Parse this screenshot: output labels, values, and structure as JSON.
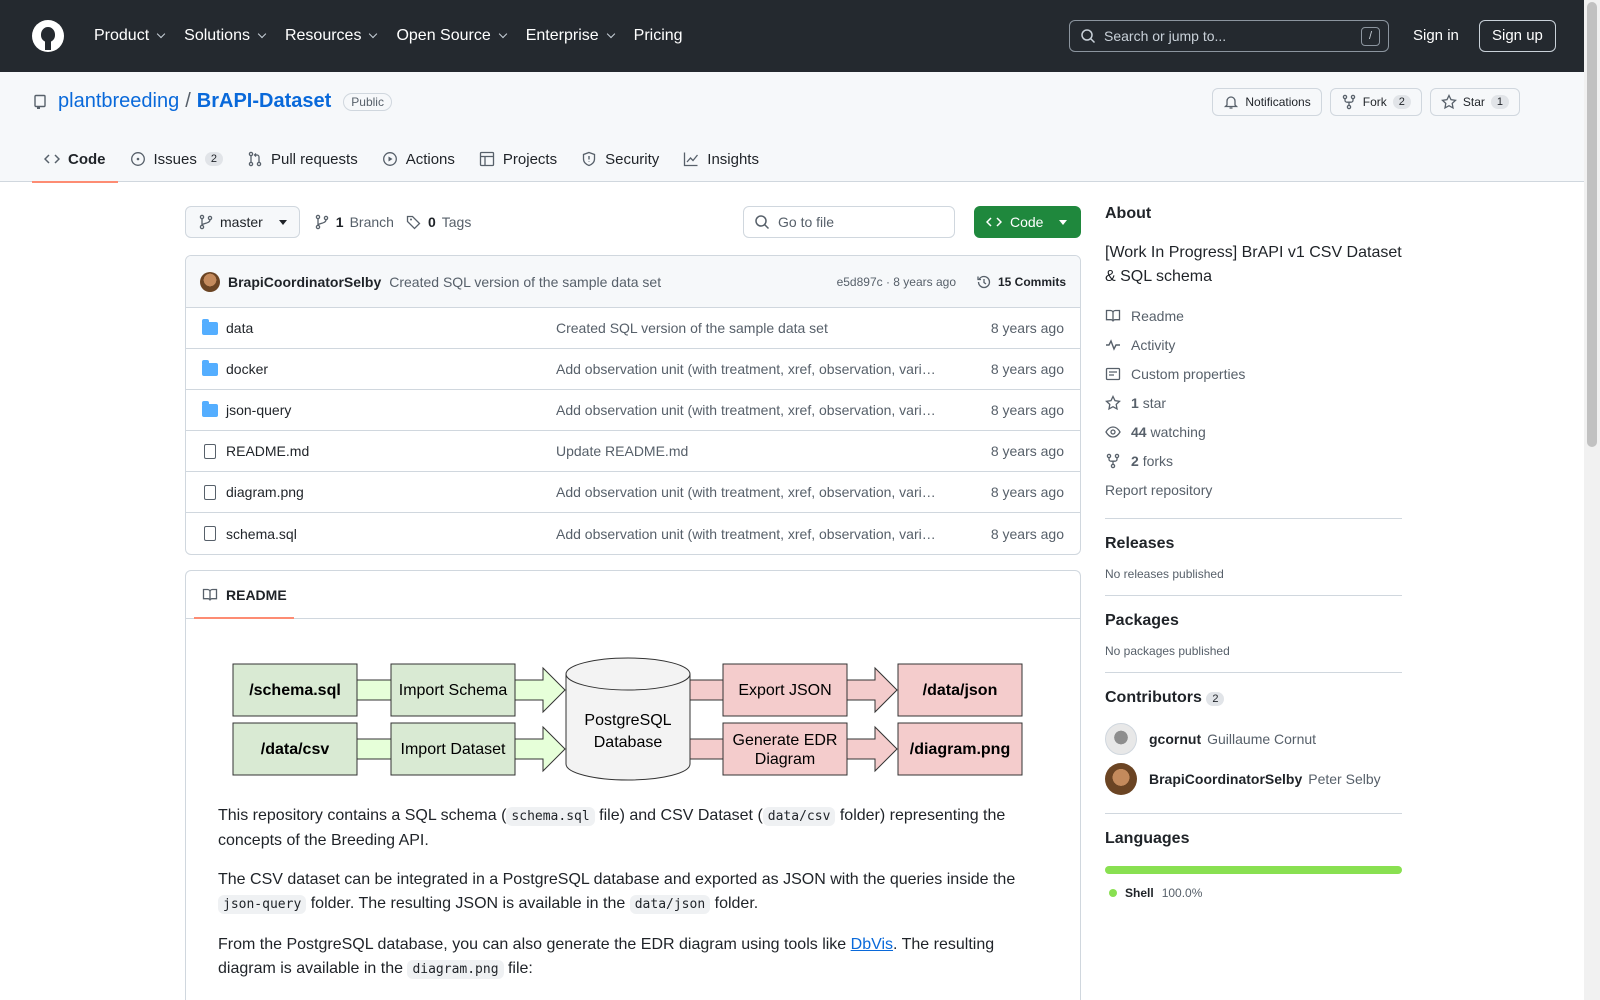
{
  "header": {
    "nav": [
      "Product",
      "Solutions",
      "Resources",
      "Open Source",
      "Enterprise",
      "Pricing"
    ],
    "search_placeholder": "Search or jump to...",
    "search_kbd": "/",
    "signin": "Sign in",
    "signup": "Sign up"
  },
  "repo": {
    "owner": "plantbreeding",
    "separator": "/",
    "name": "BrAPI-Dataset",
    "visibility": "Public",
    "notifications": "Notifications",
    "fork_label": "Fork",
    "fork_count": "2",
    "star_label": "Star",
    "star_count": "1"
  },
  "tabs": [
    {
      "label": "Code",
      "icon": "code-icon"
    },
    {
      "label": "Issues",
      "icon": "issue-icon",
      "count": "2"
    },
    {
      "label": "Pull requests",
      "icon": "pull-request-icon"
    },
    {
      "label": "Actions",
      "icon": "play-icon"
    },
    {
      "label": "Projects",
      "icon": "table-icon"
    },
    {
      "label": "Security",
      "icon": "shield-icon"
    },
    {
      "label": "Insights",
      "icon": "graph-icon"
    }
  ],
  "toolbar": {
    "branch": "master",
    "branch_count": "1",
    "branch_label": "Branch",
    "tag_count": "0",
    "tag_label": "Tags",
    "goto_placeholder": "Go to file",
    "code_button": "Code"
  },
  "commit": {
    "author": "BrapiCoordinatorSelby",
    "message": "Created SQL version of the sample data set",
    "sha": "e5d897c · 8 years ago",
    "commits": "15 Commits"
  },
  "files": [
    {
      "name": "data",
      "type": "folder",
      "message": "Created SQL version of the sample data set",
      "age": "8 years ago"
    },
    {
      "name": "docker",
      "type": "folder",
      "message": "Add observation unit (with treatment, xref, observation, vari…",
      "age": "8 years ago"
    },
    {
      "name": "json-query",
      "type": "folder",
      "message": "Add observation unit (with treatment, xref, observation, vari…",
      "age": "8 years ago"
    },
    {
      "name": "README.md",
      "type": "file",
      "message": "Update README.md",
      "age": "8 years ago"
    },
    {
      "name": "diagram.png",
      "type": "file",
      "message": "Add observation unit (with treatment, xref, observation, vari…",
      "age": "8 years ago"
    },
    {
      "name": "schema.sql",
      "type": "file",
      "message": "Add observation unit (with treatment, xref, observation, vari…",
      "age": "8 years ago"
    }
  ],
  "readme": {
    "title": "README",
    "diagram": {
      "schema_sql": "/schema.sql",
      "data_csv": "/data/csv",
      "import_schema": "Import Schema",
      "import_dataset": "Import Dataset",
      "db_line1": "PostgreSQL",
      "db_line2": "Database",
      "export_json": "Export JSON",
      "gen_edr_line1": "Generate EDR",
      "gen_edr_line2": "Diagram",
      "data_json": "/data/json",
      "diagram_png": "/diagram.png"
    },
    "p1": {
      "a": "This repository contains a SQL schema (",
      "code1": "schema.sql",
      "b": " file) and CSV Dataset (",
      "code2": "data/csv",
      "c": " folder) representing the concepts of the Breeding API."
    },
    "p2": {
      "a": "The CSV dataset can be integrated in a PostgreSQL database and exported as JSON with the queries inside the ",
      "code1": "json-query",
      "b": " folder. The resulting JSON is available in the ",
      "code2": "data/json",
      "c": " folder."
    },
    "p3": {
      "a": "From the PostgreSQL database, you can also generate the EDR diagram using tools like ",
      "link": "DbVis",
      "b": ". The resulting diagram is available in the ",
      "code1": "diagram.png",
      "c": " file:"
    }
  },
  "about": {
    "title": "About",
    "description": "[Work In Progress] BrAPI v1 CSV Dataset & SQL schema",
    "readme": "Readme",
    "activity": "Activity",
    "custom_properties": "Custom properties",
    "stars_count": "1",
    "stars_label": "star",
    "watching_count": "44",
    "watching_label": "watching",
    "forks_count": "2",
    "forks_label": "forks",
    "report": "Report repository"
  },
  "releases": {
    "title": "Releases",
    "empty": "No releases published"
  },
  "packages": {
    "title": "Packages",
    "empty": "No packages published"
  },
  "contributors": {
    "title": "Contributors",
    "count": "2",
    "list": [
      {
        "login": "gcornut",
        "name": "Guillaume Cornut"
      },
      {
        "login": "BrapiCoordinatorSelby",
        "name": "Peter Selby"
      }
    ]
  },
  "languages": {
    "title": "Languages",
    "items": [
      {
        "name": "Shell",
        "percent": "100.0%",
        "color": "#89e051"
      }
    ]
  }
}
